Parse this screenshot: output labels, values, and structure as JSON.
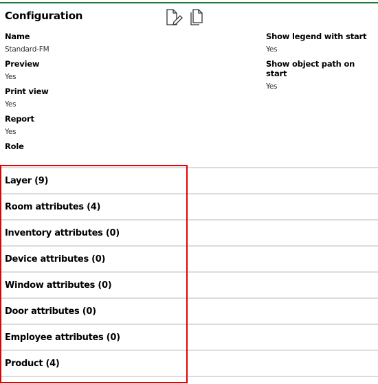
{
  "accent_color": "#1e7a3c",
  "highlight_color": "#e60000",
  "header": {
    "title": "Configuration",
    "actions": [
      {
        "name": "edit",
        "icon": "document-edit-icon"
      },
      {
        "name": "copy",
        "icon": "document-copy-icon"
      }
    ]
  },
  "properties_left": [
    {
      "label": "Name",
      "value": "Standard-FM"
    },
    {
      "label": "Preview",
      "value": "Yes"
    },
    {
      "label": "Print view",
      "value": "Yes"
    },
    {
      "label": "Report",
      "value": "Yes"
    },
    {
      "label": "Role",
      "value": ""
    }
  ],
  "properties_right": [
    {
      "label": "Show legend with start",
      "value": "Yes"
    },
    {
      "label": "Show object path on start",
      "value": "Yes"
    }
  ],
  "sections": [
    {
      "label": "Layer (9)"
    },
    {
      "label": "Room attributes (4)"
    },
    {
      "label": "Inventory attributes (0)"
    },
    {
      "label": "Device attributes (0)"
    },
    {
      "label": "Window attributes (0)"
    },
    {
      "label": "Door attributes (0)"
    },
    {
      "label": "Employee attributes (0)"
    },
    {
      "label": "Product (4)"
    }
  ]
}
